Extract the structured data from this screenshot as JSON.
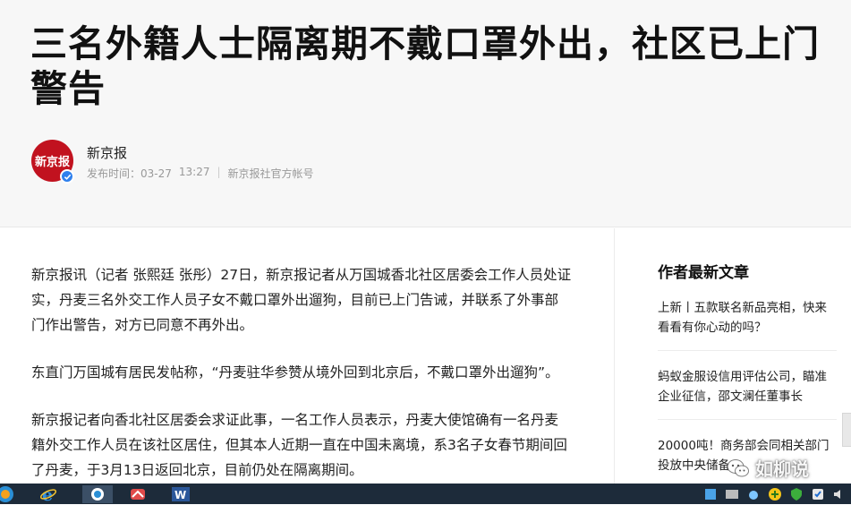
{
  "article": {
    "title": "三名外籍人士隔离期不戴口罩外出，社区已上门警告",
    "source_name": "新京报",
    "avatar_text": "新京报",
    "publish_label": "发布时间：",
    "publish_date": "03-27",
    "publish_time": "13:27",
    "account_label": "新京报社官方帐号",
    "paragraphs": [
      "新京报讯（记者 张熙廷 张彤）27日，新京报记者从万国城香北社区居委会工作人员处证实，丹麦三名外交工作人员子女不戴口罩外出遛狗，目前已上门告诫，并联系了外事部门作出警告，对方已同意不再外出。",
      "东直门万国城有居民发帖称，“丹麦驻华参赞从境外回到北京后，不戴口罩外出遛狗”。",
      "新京报记者向香北社区居委会求证此事，一名工作人员表示，丹麦大使馆确有一名丹麦籍外交工作人员在该社区居住，但其本人近期一直在中国未离境，系3名子女春节期间回了丹麦，于3月13日返回北京，目前仍处在隔离期间。"
    ]
  },
  "sidebar": {
    "title": "作者最新文章",
    "items": [
      "上新丨五款联名新品亮相，快来看看有你心动的吗？",
      "蚂蚁金服设信用评估公司，瞄准企业征信，邵文澜任董事长",
      "20000吨！商务部会同相关部门投放中央储备"
    ]
  },
  "watermark": {
    "text": "如柳说"
  },
  "taskbar": {
    "apps": [
      "start-orb",
      "internet-explorer-icon",
      "search-app-icon",
      "maps-app-icon",
      "word-icon"
    ],
    "tray": [
      "network-icon",
      "media-icon",
      "cloud-icon",
      "add-icon",
      "shield-icon",
      "security-icon",
      "speaker-icon"
    ]
  },
  "colors": {
    "brand_red": "#c1121f",
    "verified_blue": "#2f80ed",
    "taskbar": "#1d2b3a"
  }
}
